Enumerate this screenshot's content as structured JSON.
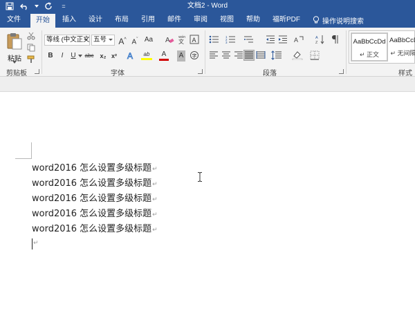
{
  "window": {
    "title": "文档2 - Word",
    "quick_access": {
      "save": "save-icon",
      "undo": "undo-icon",
      "redo": "redo-icon",
      "customize": "="
    }
  },
  "tabs": [
    {
      "label": "文件",
      "active": false
    },
    {
      "label": "开始",
      "active": true
    },
    {
      "label": "插入",
      "active": false
    },
    {
      "label": "设计",
      "active": false
    },
    {
      "label": "布局",
      "active": false
    },
    {
      "label": "引用",
      "active": false
    },
    {
      "label": "邮件",
      "active": false
    },
    {
      "label": "审阅",
      "active": false
    },
    {
      "label": "视图",
      "active": false
    },
    {
      "label": "帮助",
      "active": false
    },
    {
      "label": "福昕PDF",
      "active": false
    }
  ],
  "tell_me": {
    "label": "操作说明搜索",
    "icon": "lightbulb-icon"
  },
  "ribbon": {
    "clipboard": {
      "label": "剪贴板",
      "paste": "粘贴"
    },
    "font": {
      "label": "字体",
      "font_name": "等线 (中文正文",
      "font_size": "五号",
      "grow": "A",
      "shrink": "A",
      "case": "Aa",
      "bold": "B",
      "italic": "I",
      "underline": "U",
      "strike": "abc",
      "subscript": "x₂",
      "superscript": "x²",
      "font_color": "A",
      "char_shading": "A",
      "highlight": "ab"
    },
    "paragraph": {
      "label": "段落"
    },
    "styles": {
      "label": "样式",
      "items": [
        {
          "sample": "AaBbCcDd",
          "name": "↵ 正文"
        },
        {
          "sample": "AaBbCcDd",
          "name": "↵ 无间隔"
        }
      ]
    }
  },
  "document": {
    "lines": [
      "word2016 怎么设置多级标题",
      "word2016 怎么设置多级标题",
      "word2016 怎么设置多级标题",
      "word2016 怎么设置多级标题",
      "word2016 怎么设置多级标题"
    ],
    "paragraph_mark": "↵"
  },
  "colors": {
    "accent": "#2b579a",
    "ribbon_bg": "#f3f3f3",
    "highlight": "#ffff00",
    "font_color": "#d00000"
  }
}
